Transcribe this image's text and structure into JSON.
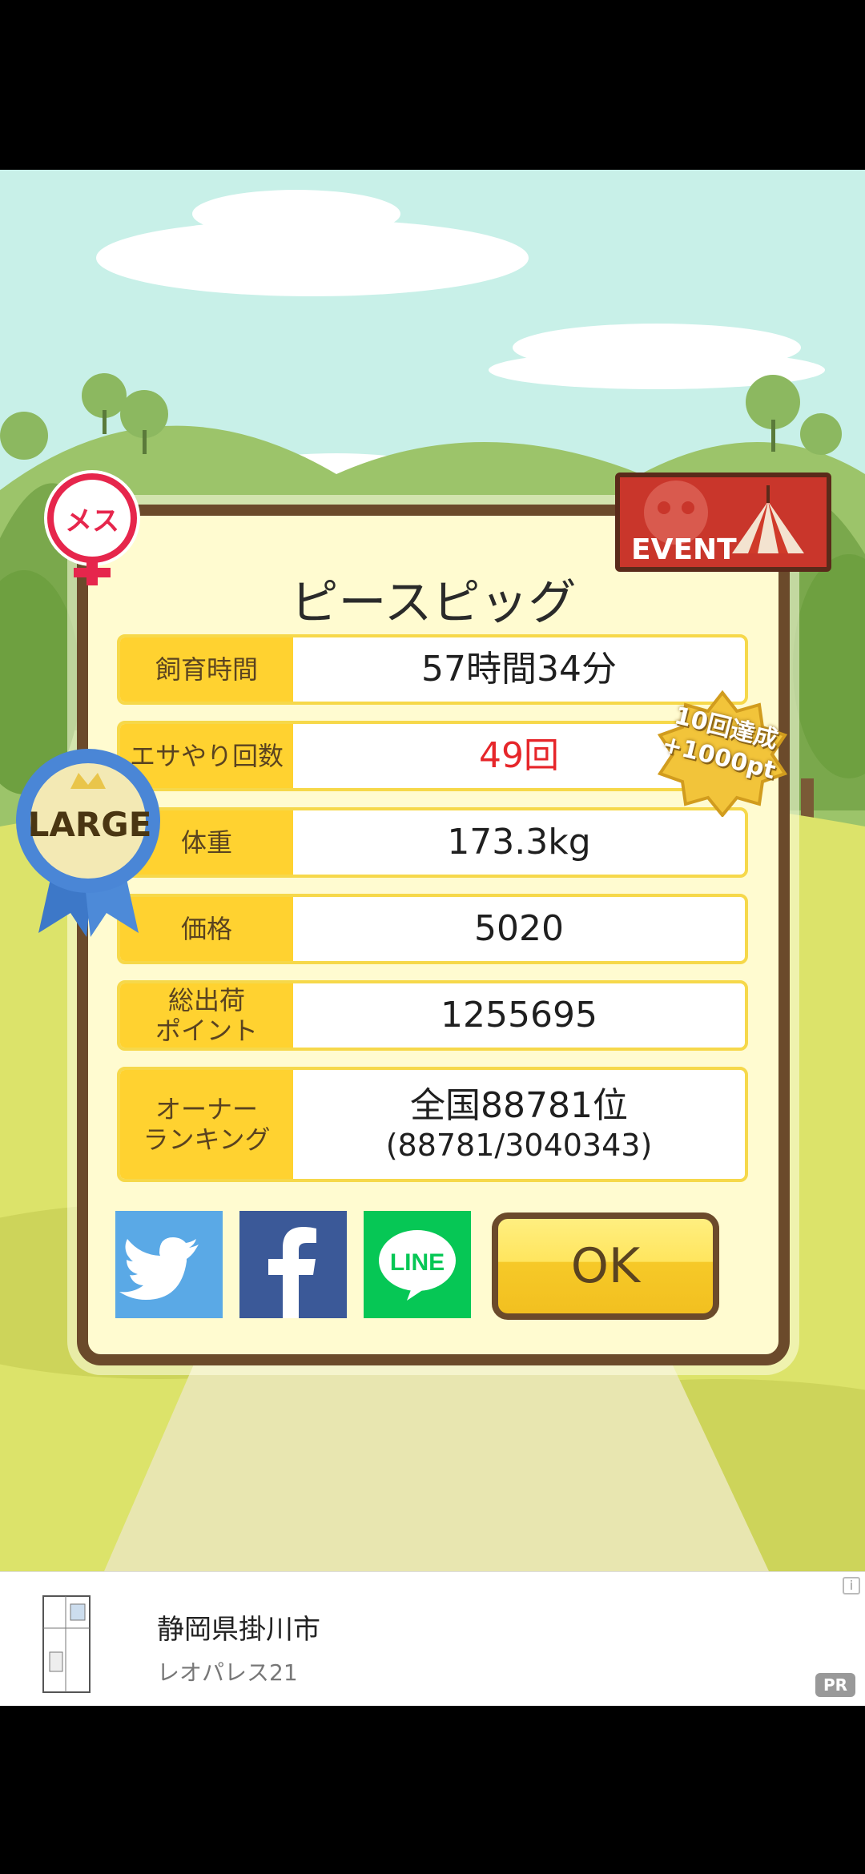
{
  "dialog": {
    "title": "ピースピッグ",
    "gender_label": "メス",
    "event_label": "EVENT",
    "ribbon_label": "LARGE",
    "badge": {
      "line1": "10回達成",
      "line2": "+1000pt"
    },
    "rows": [
      {
        "label": "飼育時間",
        "value": "57時間34分"
      },
      {
        "label": "エサやり回数",
        "value": "49回"
      },
      {
        "label": "体重",
        "value": "173.3kg"
      },
      {
        "label": "価格",
        "value": "5020"
      },
      {
        "label": "総出荷\nポイント",
        "value": "1255695"
      },
      {
        "label": "オーナー\nランキング",
        "value": "全国88781位",
        "value2": "(88781/3040343)"
      }
    ],
    "share": {
      "twitter": "twitter-icon",
      "facebook": "facebook-icon",
      "line": "LINE"
    },
    "ok_label": "OK"
  },
  "ad": {
    "title": "静岡県掛川市",
    "subtitle": "レオパレス21",
    "info": "i",
    "pr": "PR"
  },
  "colors": {
    "frame": "#6b4a2b",
    "panel": "#fffbd0",
    "label_bg": "#ffd230",
    "accent_red": "#e6262a",
    "twitter": "#5aa9e6",
    "facebook": "#3b5998",
    "line": "#06c755"
  }
}
